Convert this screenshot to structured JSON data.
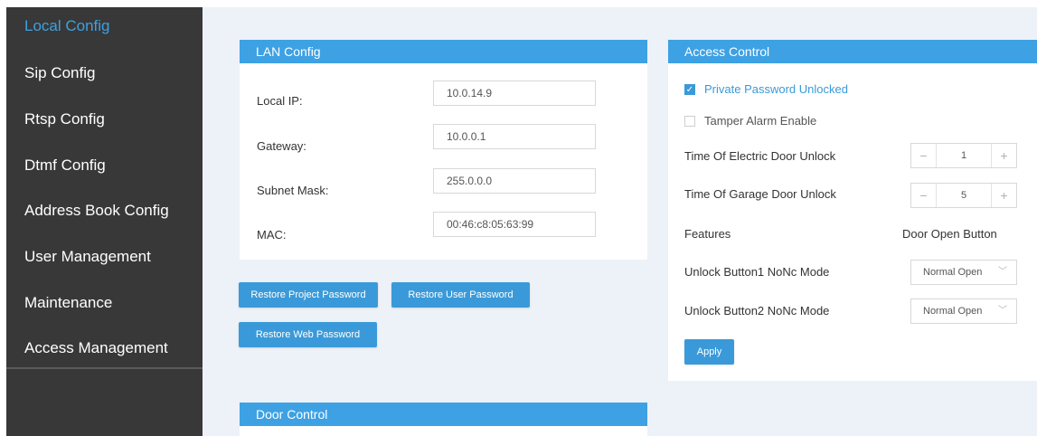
{
  "sidebar": {
    "items": [
      {
        "label": "Local Config",
        "active": true
      },
      {
        "label": "Sip Config"
      },
      {
        "label": "Rtsp Config"
      },
      {
        "label": "Dtmf Config"
      },
      {
        "label": "Address Book Config"
      },
      {
        "label": "User Management"
      },
      {
        "label": "Maintenance"
      },
      {
        "label": "Access Management"
      }
    ]
  },
  "lan_config": {
    "title": "LAN Config",
    "local_ip": {
      "label": "Local IP:",
      "value": "10.0.14.9"
    },
    "gateway": {
      "label": "Gateway:",
      "value": "10.0.0.1"
    },
    "subnet_mask": {
      "label": "Subnet Mask:",
      "value": "255.0.0.0"
    },
    "mac": {
      "label": "MAC:",
      "value": "00:46:c8:05:63:99"
    }
  },
  "buttons": {
    "restore_project_password": "Restore Project Password",
    "restore_user_password": "Restore User Password",
    "restore_web_password": "Restore Web Password"
  },
  "door_control": {
    "title": "Door Control"
  },
  "access_control": {
    "title": "Access Control",
    "private_password_unlocked": {
      "label": "Private Password Unlocked",
      "checked": true
    },
    "tamper_alarm_enable": {
      "label": "Tamper Alarm Enable",
      "checked": false
    },
    "electric_door_unlock": {
      "label": "Time Of Electric Door Unlock",
      "value": "1"
    },
    "garage_door_unlock": {
      "label": "Time Of Garage Door Unlock",
      "value": "5"
    },
    "features_label": "Features",
    "door_open_button_label": "Door Open Button",
    "unlock_button1": {
      "label": "Unlock Button1 NoNc Mode",
      "value": "Normal Open"
    },
    "unlock_button2": {
      "label": "Unlock Button2 NoNc Mode",
      "value": "Normal Open"
    },
    "apply_label": "Apply"
  },
  "colors": {
    "accent": "#3ea1e3",
    "sidebar_bg": "#383838",
    "content_bg": "#edf1f8",
    "active_nav": "#3fa0df"
  }
}
